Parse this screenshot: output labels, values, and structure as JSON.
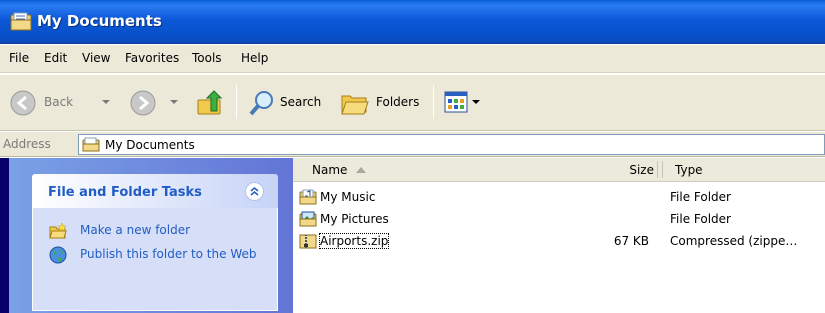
{
  "window": {
    "title": "My Documents"
  },
  "menu": [
    "File",
    "Edit",
    "View",
    "Favorites",
    "Tools",
    "Help"
  ],
  "toolbar": {
    "back": "Back",
    "search": "Search",
    "folders": "Folders"
  },
  "address": {
    "label": "Address",
    "value": "My Documents"
  },
  "tasks": {
    "title": "File and Folder Tasks",
    "links": [
      "Make a new folder",
      "Publish this folder to the Web"
    ]
  },
  "files": {
    "columns": {
      "name": "Name",
      "size": "Size",
      "type": "Type"
    },
    "rows": [
      {
        "name": "My Music",
        "size": "",
        "type": "File Folder",
        "icon": "music-folder-icon"
      },
      {
        "name": "My Pictures",
        "size": "",
        "type": "File Folder",
        "icon": "pictures-folder-icon"
      },
      {
        "name": "Airports.zip",
        "size": "67 KB",
        "type": "Compressed (zippe…",
        "icon": "zip-file-icon"
      }
    ]
  },
  "colors": {
    "title_bar": "#0a58d8",
    "task_link": "#215dc6",
    "pane_bg": "#6f8fe0"
  }
}
